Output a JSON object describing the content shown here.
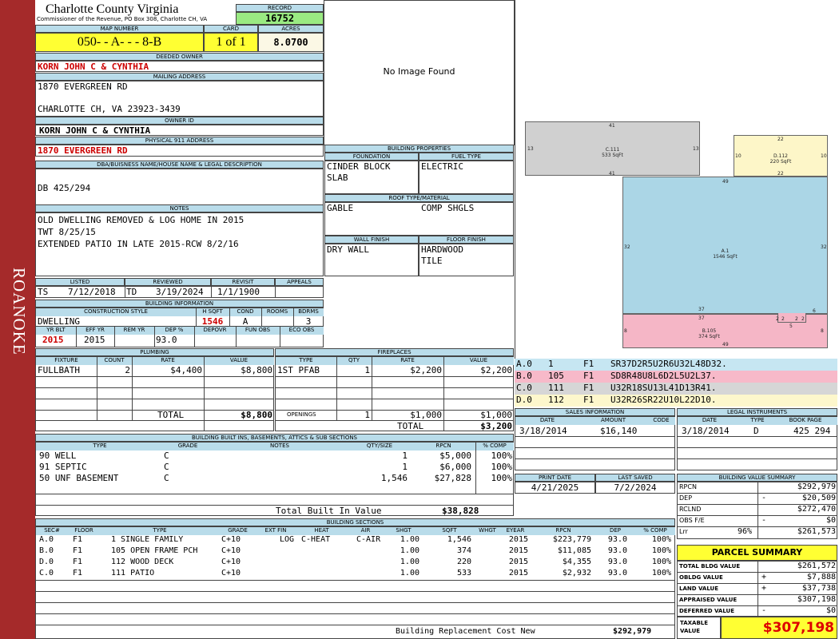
{
  "side_label": "ROANOKE",
  "county": "Charlotte County Virginia",
  "commissioner": "Commissioner of the Revenue, PO Box 308, Charlotte CH, VA",
  "record": {
    "label": "RECORD",
    "value": "16752"
  },
  "map": {
    "label": "MAP NUMBER",
    "value": "050- - A- - - 8-B"
  },
  "card": {
    "label": "CARD",
    "value": "1 of 1"
  },
  "acres": {
    "label": "ACRES",
    "value": "8.0700"
  },
  "deeded_owner": {
    "label": "DEEDED OWNER",
    "value": "KORN JOHN C & CYNTHIA"
  },
  "mailing": {
    "label": "MAILING ADDRESS",
    "line1": "1870 EVERGREEN RD",
    "line2": "CHARLOTTE CH, VA 23923-3439"
  },
  "owner_id": {
    "label": "OWNER ID",
    "value": "KORN JOHN C & CYNTHIA"
  },
  "physical": {
    "label": "PHYSICAL 911 ADDRESS",
    "value": "1870 EVERGREEN RD"
  },
  "dba": {
    "label": "DBA/BUISNESS NAME/HOUSE NAME & LEGAL DESCRIPTION",
    "value": "DB 425/294"
  },
  "notes": {
    "label": "NOTES",
    "lines": [
      "OLD DWELLING REMOVED & LOG HOME IN 2015",
      "TWT 8/25/15",
      "EXTENDED PATIO IN LATE 2015-RCW 8/2/16"
    ]
  },
  "photo_text": "No Image Found",
  "listed": {
    "label": "LISTED",
    "code": "TS",
    "date": "7/12/2018"
  },
  "reviewed": {
    "label": "REVIEWED",
    "code": "TD",
    "date": "3/19/2024"
  },
  "revisit": {
    "label": "REVISIT",
    "date": "1/1/1900"
  },
  "appeals": {
    "label": "APPEALS",
    "value": ""
  },
  "bldg_info": {
    "label": "BUILDING INFORMATION",
    "h_style": "CONSTRUCTION STYLE",
    "h_hsqft": "H SQFT",
    "h_cond": "COND",
    "h_rooms": "ROOMS",
    "h_bdrms": "BDRMS",
    "style": "DWELLING",
    "hsqft": "1546",
    "cond": "A",
    "rooms": "",
    "bdrms": "3",
    "h_yrblt": "YR BLT",
    "h_effyr": "EFF YR",
    "h_remyr": "REM YR",
    "h_dep": "DEP %",
    "h_depovr": "DEPOVR",
    "h_funobs": "FUN OBS",
    "h_ecoobs": "ECO OBS",
    "yrblt": "2015",
    "effyr": "2015",
    "remyr": "",
    "dep": "93.0",
    "depovr": "",
    "funobs": "",
    "ecoobs": ""
  },
  "props": {
    "label": "BUILDING PROPERTIES",
    "foundation_h": "FOUNDATION",
    "fuel_h": "FUEL TYPE",
    "foundation": [
      "CINDER BLOCK",
      "SLAB"
    ],
    "fuel": "ELECTRIC",
    "roof_h": "ROOF TYPE/MATERIAL",
    "roof_type": "GABLE",
    "roof_mat": "COMP SHGLS",
    "wall_h": "WALL FINISH",
    "floor_h": "FLOOR FINISH",
    "wall": "DRY WALL",
    "floor": [
      "HARDWOOD",
      "TILE"
    ]
  },
  "plumbing": {
    "label": "PLUMBING",
    "cols": [
      "FIXTURE",
      "COUNT",
      "RATE",
      "VALUE"
    ],
    "rows": [
      [
        "FULLBATH",
        "2",
        "$4,400",
        "$8,800"
      ]
    ],
    "total_label": "TOTAL",
    "total": "$8,800"
  },
  "fireplaces": {
    "label": "FIREPLACES",
    "cols": [
      "TYPE",
      "QTY",
      "RATE",
      "VALUE"
    ],
    "rows": [
      [
        "1ST PFAB",
        "1",
        "$2,200",
        "$2,200"
      ]
    ],
    "openings_label": "OPENINGS",
    "openings": [
      "1",
      "$1,000",
      "$1,000"
    ],
    "total_label": "TOTAL",
    "total": "$3,200"
  },
  "builtins": {
    "label": "BUILDING BUILT INS, BASEMENTS, ATTICS & SUB SECTIONS",
    "cols": [
      "TYPE",
      "GRADE",
      "NOTES",
      "QTY/SIZE",
      "RPCN",
      "% COMP"
    ],
    "rows": [
      [
        "90 WELL",
        "C",
        "",
        "1",
        "$5,000",
        "100%"
      ],
      [
        "91 SEPTIC",
        "C",
        "",
        "1",
        "$6,000",
        "100%"
      ],
      [
        "50 UNF BASEMENT",
        "C",
        "",
        "1,546",
        "$27,828",
        "100%"
      ]
    ],
    "total_label": "Total Built In Value",
    "total": "$38,828"
  },
  "sections": {
    "label": "BUILDING SECTIONS",
    "cols": [
      "SEC#",
      "FLOOR",
      "TYPE",
      "GRADE",
      "EXT FIN",
      "HEAT",
      "AIR",
      "SHGT",
      "SQFT",
      "WHGT",
      "EYEAR",
      "RPCN",
      "DEP",
      "% COMP"
    ],
    "rows": [
      [
        "A.0",
        "F1",
        "1 SINGLE FAMILY",
        "C+10",
        "LOG",
        "C-HEAT",
        "C-AIR",
        "1.00",
        "1,546",
        "",
        "2015",
        "$223,779",
        "93.0",
        "100%"
      ],
      [
        "B.0",
        "F1",
        "105 OPEN FRAME PCH",
        "C+10",
        "",
        "",
        "",
        "1.00",
        "374",
        "",
        "2015",
        "$11,085",
        "93.0",
        "100%"
      ],
      [
        "D.0",
        "F1",
        "112 WOOD DECK",
        "C+10",
        "",
        "",
        "",
        "1.00",
        "220",
        "",
        "2015",
        "$4,355",
        "93.0",
        "100%"
      ],
      [
        "C.0",
        "F1",
        "111 PATIO",
        "C+10",
        "",
        "",
        "",
        "1.00",
        "533",
        "",
        "2015",
        "$2,932",
        "93.0",
        "100%"
      ]
    ],
    "total_label": "Building Replacement Cost New",
    "total": "$292,979"
  },
  "sketch": {
    "areas": [
      {
        "id": "C.111",
        "sqft": "533 SqFt",
        "color": "#d0d0d0",
        "dims": [
          "41",
          "13",
          "41",
          "13"
        ]
      },
      {
        "id": "D.112",
        "sqft": "220 SqFt",
        "color": "#fdf6c8",
        "dims": [
          "22",
          "10",
          "22",
          "10"
        ]
      },
      {
        "id": "A.1",
        "sqft": "1546 SqFt",
        "color": "#abd6e6",
        "dims": [
          "49",
          "32",
          "37",
          "32"
        ]
      },
      {
        "id": "B.105",
        "sqft": "374 SqFt",
        "color": "#f5b6c6",
        "dims": [
          "37",
          "8",
          "49",
          "8",
          "6"
        ]
      }
    ],
    "small_dims": [
      "2",
      "2",
      "5",
      "2",
      "2",
      "5"
    ]
  },
  "sketch_codes": [
    {
      "sec": "A.0",
      "num": "1",
      "fl": "F1",
      "code": "SR37D2R5U2R6U32L48D32.",
      "color": "#c6e6f2"
    },
    {
      "sec": "B.0",
      "num": "105",
      "fl": "F1",
      "code": "SD8R48U8L6D2L5U2L37.",
      "color": "#f7b9c9"
    },
    {
      "sec": "C.0",
      "num": "111",
      "fl": "F1",
      "code": "U32R18SU13L41D13R41.",
      "color": "#d6d6d6"
    },
    {
      "sec": "D.0",
      "num": "112",
      "fl": "F1",
      "code": "U32R26SR22U10L22D10.",
      "color": "#fdf7cc"
    }
  ],
  "sales": {
    "label": "SALES INFORMATION",
    "cols": [
      "DATE",
      "AMOUNT",
      "CODE"
    ],
    "rows": [
      [
        "3/18/2014",
        "$16,140",
        ""
      ]
    ]
  },
  "legal": {
    "label": "LEGAL INSTRUMENTS",
    "cols": [
      "DATE",
      "TYPE",
      "BOOK PAGE"
    ],
    "rows": [
      [
        "3/18/2014",
        "D",
        "425 294"
      ]
    ]
  },
  "print_date": {
    "label": "PRINT DATE",
    "value": "4/21/2025"
  },
  "last_saved": {
    "label": "LAST SAVED",
    "value": "7/2/2024"
  },
  "bvs": {
    "label": "BUILDING VALUE SUMMARY",
    "rows": [
      [
        "RPCN",
        "",
        "$292,979"
      ],
      [
        "DEP",
        "-",
        "$20,509"
      ],
      [
        "RCLND",
        "",
        "$272,470"
      ],
      [
        "OBS F/E",
        "-",
        "$0"
      ],
      [
        "Lrr",
        "96%",
        "$261,573"
      ]
    ]
  },
  "parcel": {
    "label": "PARCEL SUMMARY",
    "rows": [
      [
        "TOTAL BLDG VALUE",
        "",
        "$261,572"
      ],
      [
        "OBLDG VALUE",
        "+",
        "$7,888"
      ],
      [
        "LAND VALUE",
        "+",
        "$37,738"
      ],
      [
        "APPRAISED VALUE",
        "",
        "$307,198"
      ],
      [
        "DEFERRED VALUE",
        "-",
        "$0"
      ]
    ],
    "taxable_label": "TAXABLE VALUE",
    "taxable": "$307,198"
  }
}
